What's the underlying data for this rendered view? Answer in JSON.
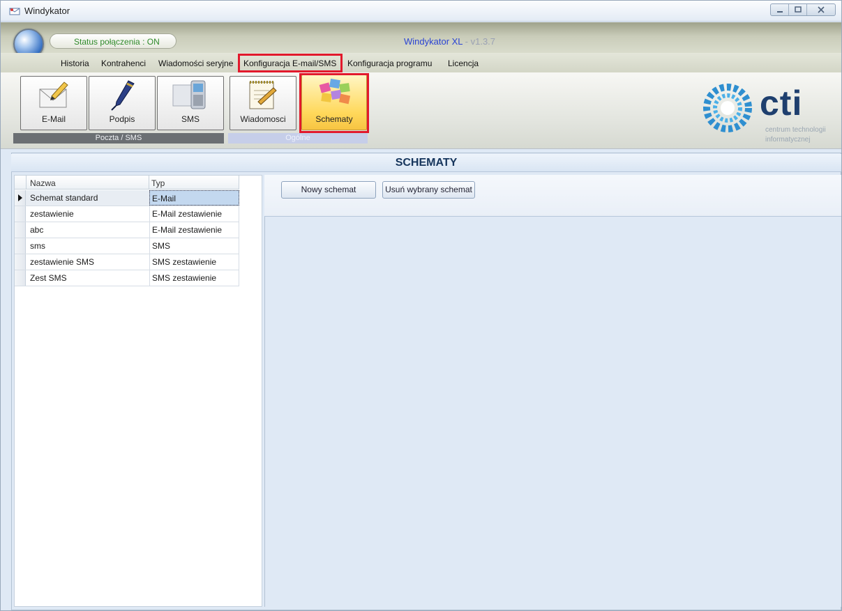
{
  "window": {
    "title": "Windykator",
    "controls": [
      "minimize-icon",
      "maximize-icon",
      "close-icon"
    ]
  },
  "header": {
    "status": "Status połączenia : ON",
    "app_name": "Windykator XL",
    "app_version": " - v1.3.7"
  },
  "menu": {
    "items": [
      {
        "label": "Historia"
      },
      {
        "label": "Kontrahenci"
      },
      {
        "label": "Wiadomości seryjne"
      },
      {
        "label": "Konfiguracja E-mail/SMS",
        "active": true
      },
      {
        "label": "Konfiguracja programu"
      },
      {
        "label": "Licencja"
      }
    ]
  },
  "ribbon": {
    "groups": [
      {
        "label": "Poczta / SMS",
        "tiles": [
          {
            "label": "E-Mail",
            "icon": "email-icon"
          },
          {
            "label": "Podpis",
            "icon": "pen-icon"
          },
          {
            "label": "SMS",
            "icon": "phone-icon"
          }
        ]
      },
      {
        "label": "Ogólne",
        "tiles": [
          {
            "label": "Wiadomosci",
            "icon": "notepad-icon"
          },
          {
            "label": "Schematy",
            "icon": "palette-icon",
            "active": true
          }
        ]
      }
    ],
    "brand": {
      "name": "cti",
      "line1": "centrum technologii",
      "line2": "informatycznej"
    }
  },
  "section": {
    "title": "SCHEMATY"
  },
  "grid": {
    "headers": [
      "Nazwa",
      "Typ"
    ],
    "rows": [
      {
        "name": "Schemat standard",
        "type": "E-Mail",
        "selected": true
      },
      {
        "name": "zestawienie",
        "type": "E-Mail zestawienie"
      },
      {
        "name": "abc",
        "type": "E-Mail zestawienie"
      },
      {
        "name": "sms",
        "type": "SMS"
      },
      {
        "name": "zestawienie SMS",
        "type": "SMS zestawienie"
      },
      {
        "name": "Zest SMS",
        "type": "SMS zestawienie"
      }
    ]
  },
  "actions": {
    "new_label": "Nowy schemat",
    "delete_label": "Usuń wybrany schemat"
  },
  "colors": {
    "accent_blue": "#2a44d4",
    "status_green": "#2f8a2a",
    "highlight_red": "#e2192c",
    "active_tile": "#ffd85a"
  }
}
